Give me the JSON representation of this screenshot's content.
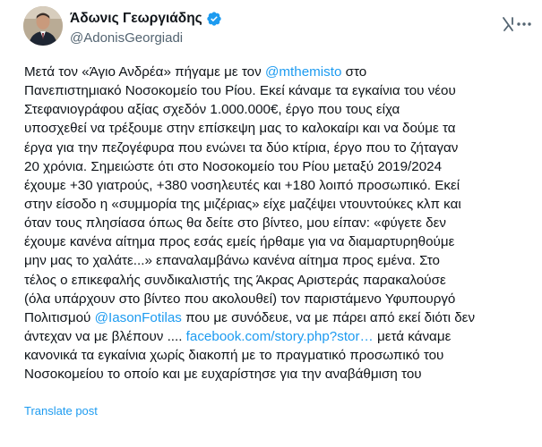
{
  "author": {
    "display_name": "Άδωνις Γεωργιάδης",
    "handle": "@AdonisGeorgiadi",
    "verified": true,
    "avatar_icon": "person-avatar-icon"
  },
  "header_icons": {
    "grok": "grok-icon",
    "more": "more-options-icon"
  },
  "tweet": {
    "lines": [
      [
        {
          "t": "Μετά τον «Άγιο Ανδρέα» πήγαμε με τον "
        },
        {
          "t": "@mthemisto",
          "m": 1
        },
        {
          "t": " στο"
        }
      ],
      [
        {
          "t": "Πανεπιστημιακό Νοσοκομείο του Ρίου. Εκεί κάναμε τα εγκαίνια του νέου"
        }
      ],
      [
        {
          "t": "Στεφανιογράφου αξίας σχεδόν 1.000.000€, έργο που τους είχα"
        }
      ],
      [
        {
          "t": "υποσχεθεί να τρέξουμε στην επίσκεψη μας το καλοκαίρι και να δούμε τα"
        }
      ],
      [
        {
          "t": "έργα για την πεζογέφυρα που ενώνει τα δύο κτίρια, έργο που το ζήταγαν"
        }
      ],
      [
        {
          "t": "20 χρόνια. Σημειώστε ότι στο Νοσοκομείο του Ρίου μεταξύ 2019/2024"
        }
      ],
      [
        {
          "t": "έχουμε +30 γιατρούς, +380 νοσηλευτές και +180 λοιπό προσωπικό. Εκεί"
        }
      ],
      [
        {
          "t": "στην είσοδο η «συμμορία της μιζέριας» είχε μαζέψει ντουντούκες κλπ και"
        }
      ],
      [
        {
          "t": "όταν τους πλησίασα όπως θα δείτε στο βίντεο, μου είπαν: «φύγετε δεν"
        }
      ],
      [
        {
          "t": "έχουμε κανένα αίτημα προς εσάς εμείς ήρθαμε για να διαμαρτυρηθούμε"
        }
      ],
      [
        {
          "t": "μην μας το χαλάτε...» επαναλαμβάνω κανένα αίτημα προς εμένα. Στο"
        }
      ],
      [
        {
          "t": "τέλος ο επικεφαλής συνδικαλιστής της Άκρας Αριστεράς παρακαλούσε"
        }
      ],
      [
        {
          "t": "(όλα υπάρχουν στο βίντεο που ακολουθεί) τον παριστάμενο Υφυπουργό"
        }
      ],
      [
        {
          "t": "Πολιτισμού "
        },
        {
          "t": "@IasonFotilas",
          "m": 1
        },
        {
          "t": " που με συνόδευε, να με πάρει από εκεί διότι δεν"
        }
      ],
      [
        {
          "t": "άντεχαν να με βλέπουν .... "
        },
        {
          "t": "facebook.com/story.php?stor…",
          "m": 1
        },
        {
          "t": " μετά κάναμε"
        }
      ],
      [
        {
          "t": "κανονικά τα εγκαίνια χωρίς διακοπή με το πραγματικό προσωπικό του"
        }
      ],
      [
        {
          "t": "Νοσοκομείου το οποίο και με ευχαρίστησε για την αναβάθμιση του"
        }
      ]
    ]
  },
  "translate_label": "Translate post",
  "colors": {
    "text": "#0f1419",
    "secondary": "#536471",
    "link": "#1d9bf0",
    "verified": "#1d9bf0"
  }
}
